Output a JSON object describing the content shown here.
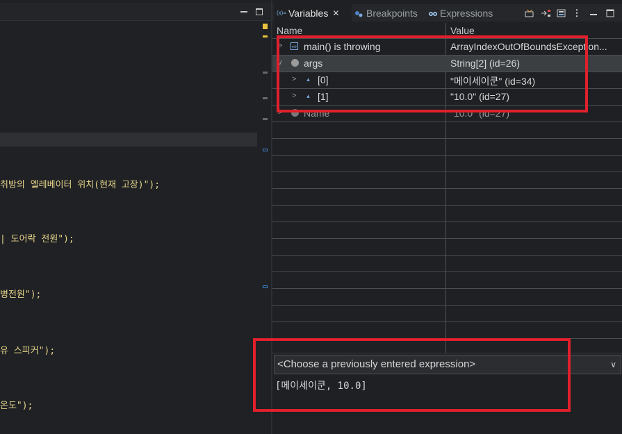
{
  "editor": {
    "code_lines": [
      "취방의 엘레베이터 위치(현재 고장)\");",
      "| 도어락 전원\");",
      "병전원\");",
      "유 스피커\");",
      "온도\");"
    ]
  },
  "view": {
    "tabs": [
      {
        "label": "Variables",
        "icon": "variables-icon",
        "active": true
      },
      {
        "label": "Breakpoints",
        "icon": "breakpoints-icon",
        "active": false
      },
      {
        "label": "Expressions",
        "icon": "expressions-icon",
        "active": false
      }
    ],
    "tab_icon_text": "(x)=",
    "columns": {
      "name": "Name",
      "value": "Value"
    },
    "rows": [
      {
        "name": "main() is throwing",
        "value": "ArrayIndexOutOfBoundsException...",
        "icon": "exception-icon",
        "expand": ">",
        "selected": false
      },
      {
        "name": "args",
        "value": "String[2]  (id=26)",
        "icon": "local-variable-icon",
        "expand": "v",
        "selected": true
      },
      {
        "name": "[0]",
        "value": "\"메이세이쿤\" (id=34)",
        "icon": "array-element-icon",
        "expand": ">",
        "selected": false
      },
      {
        "name": "[1]",
        "value": "\"10.0\" (id=27)",
        "icon": "array-element-icon",
        "expand": ">",
        "selected": false
      },
      {
        "name": "Name",
        "value": "\"10.0\" (id=27)",
        "icon": "local-variable-icon",
        "expand": ">",
        "selected": false
      }
    ],
    "detail": {
      "combo_placeholder": "<Choose a previously entered expression>",
      "result": "[메이세이쿤, 10.0]"
    }
  },
  "colors": {
    "highlight_box": "#e0202c",
    "code_string": "#e6d48a",
    "selection": "#3c3f42"
  }
}
